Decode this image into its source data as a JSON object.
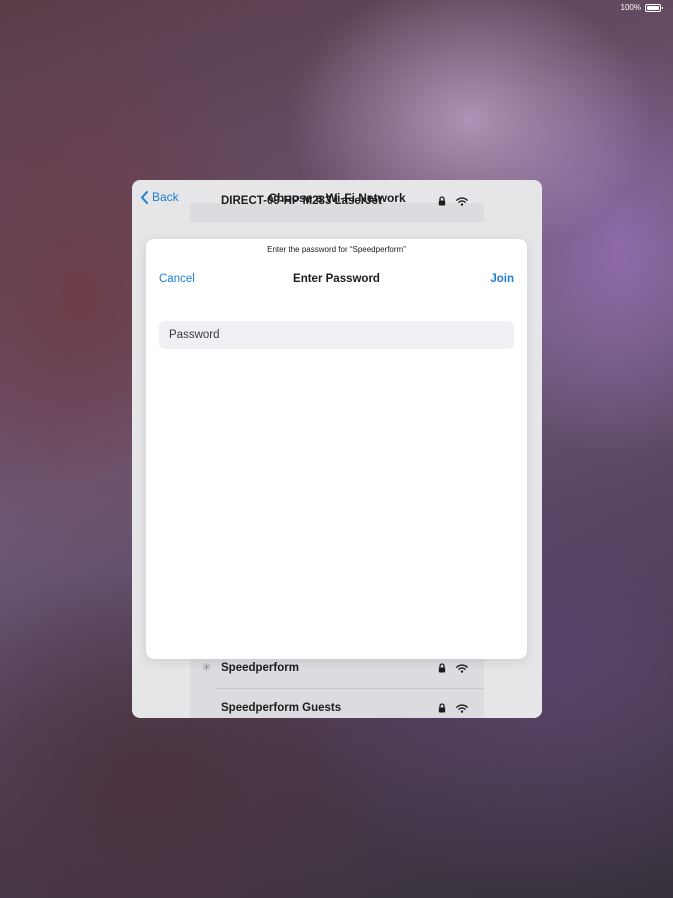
{
  "status_bar": {
    "battery_text": "100%"
  },
  "wifi_sheet": {
    "back_label": "Back",
    "title": "Choose a Wi-Fi Network",
    "networks_top": [
      {
        "name": "DIRECT-09-HP M283 LaserJet",
        "locked": true
      }
    ],
    "networks_bottom": [
      {
        "name": "Speedperform",
        "locked": true,
        "connecting": true
      },
      {
        "name": "Speedperform Guests",
        "locked": true
      }
    ]
  },
  "password_modal": {
    "prompt": "Enter the password for “Speedperform”",
    "cancel_label": "Cancel",
    "title": "Enter Password",
    "join_label": "Join",
    "password_placeholder": "Password",
    "password_value": ""
  },
  "icons": {
    "lock": "lock-icon",
    "wifi": "wifi-icon",
    "back": "chevron-left-icon",
    "battery": "battery-icon",
    "spinner": "activity-spinner-icon"
  },
  "colors": {
    "accent": "#1c7fd4"
  }
}
